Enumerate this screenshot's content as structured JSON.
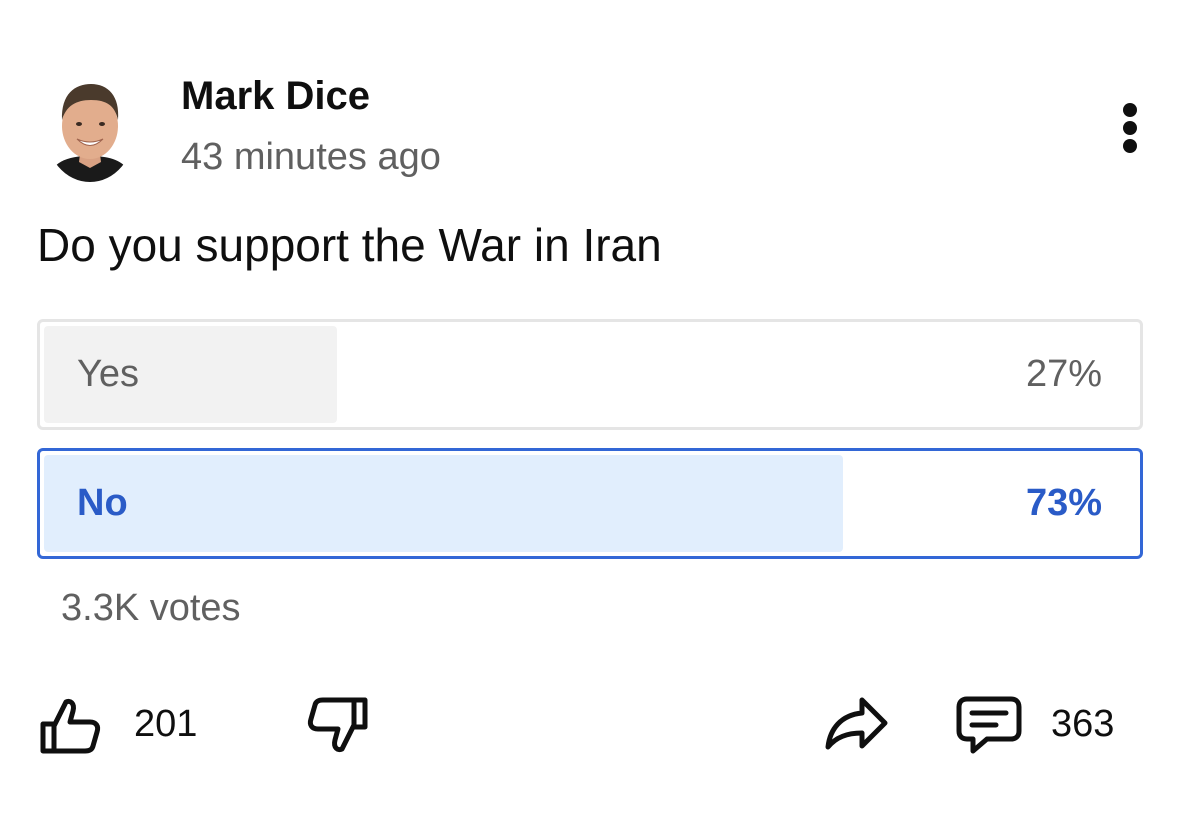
{
  "post": {
    "author": "Mark Dice",
    "timestamp": "43 minutes ago",
    "avatar_icon": "profile-photo",
    "menu_icon": "vertical-ellipsis-icon"
  },
  "poll": {
    "question": "Do you support the War in Iran",
    "options": [
      {
        "label": "Yes",
        "percent_text": "27%",
        "percent": 27,
        "selected": false
      },
      {
        "label": "No",
        "percent_text": "73%",
        "percent": 73,
        "selected": true
      }
    ],
    "votes": "3.3K votes"
  },
  "actions": {
    "like_icon": "thumbs-up-icon",
    "like_count": "201",
    "dislike_icon": "thumbs-down-icon",
    "share_icon": "share-arrow-icon",
    "comment_icon": "comment-icon",
    "comment_count": "363"
  },
  "colors": {
    "accent": "#3367d6",
    "selected_fill": "#e1eefd",
    "unselected_fill": "#f2f2f2",
    "secondary_text": "#606060"
  }
}
